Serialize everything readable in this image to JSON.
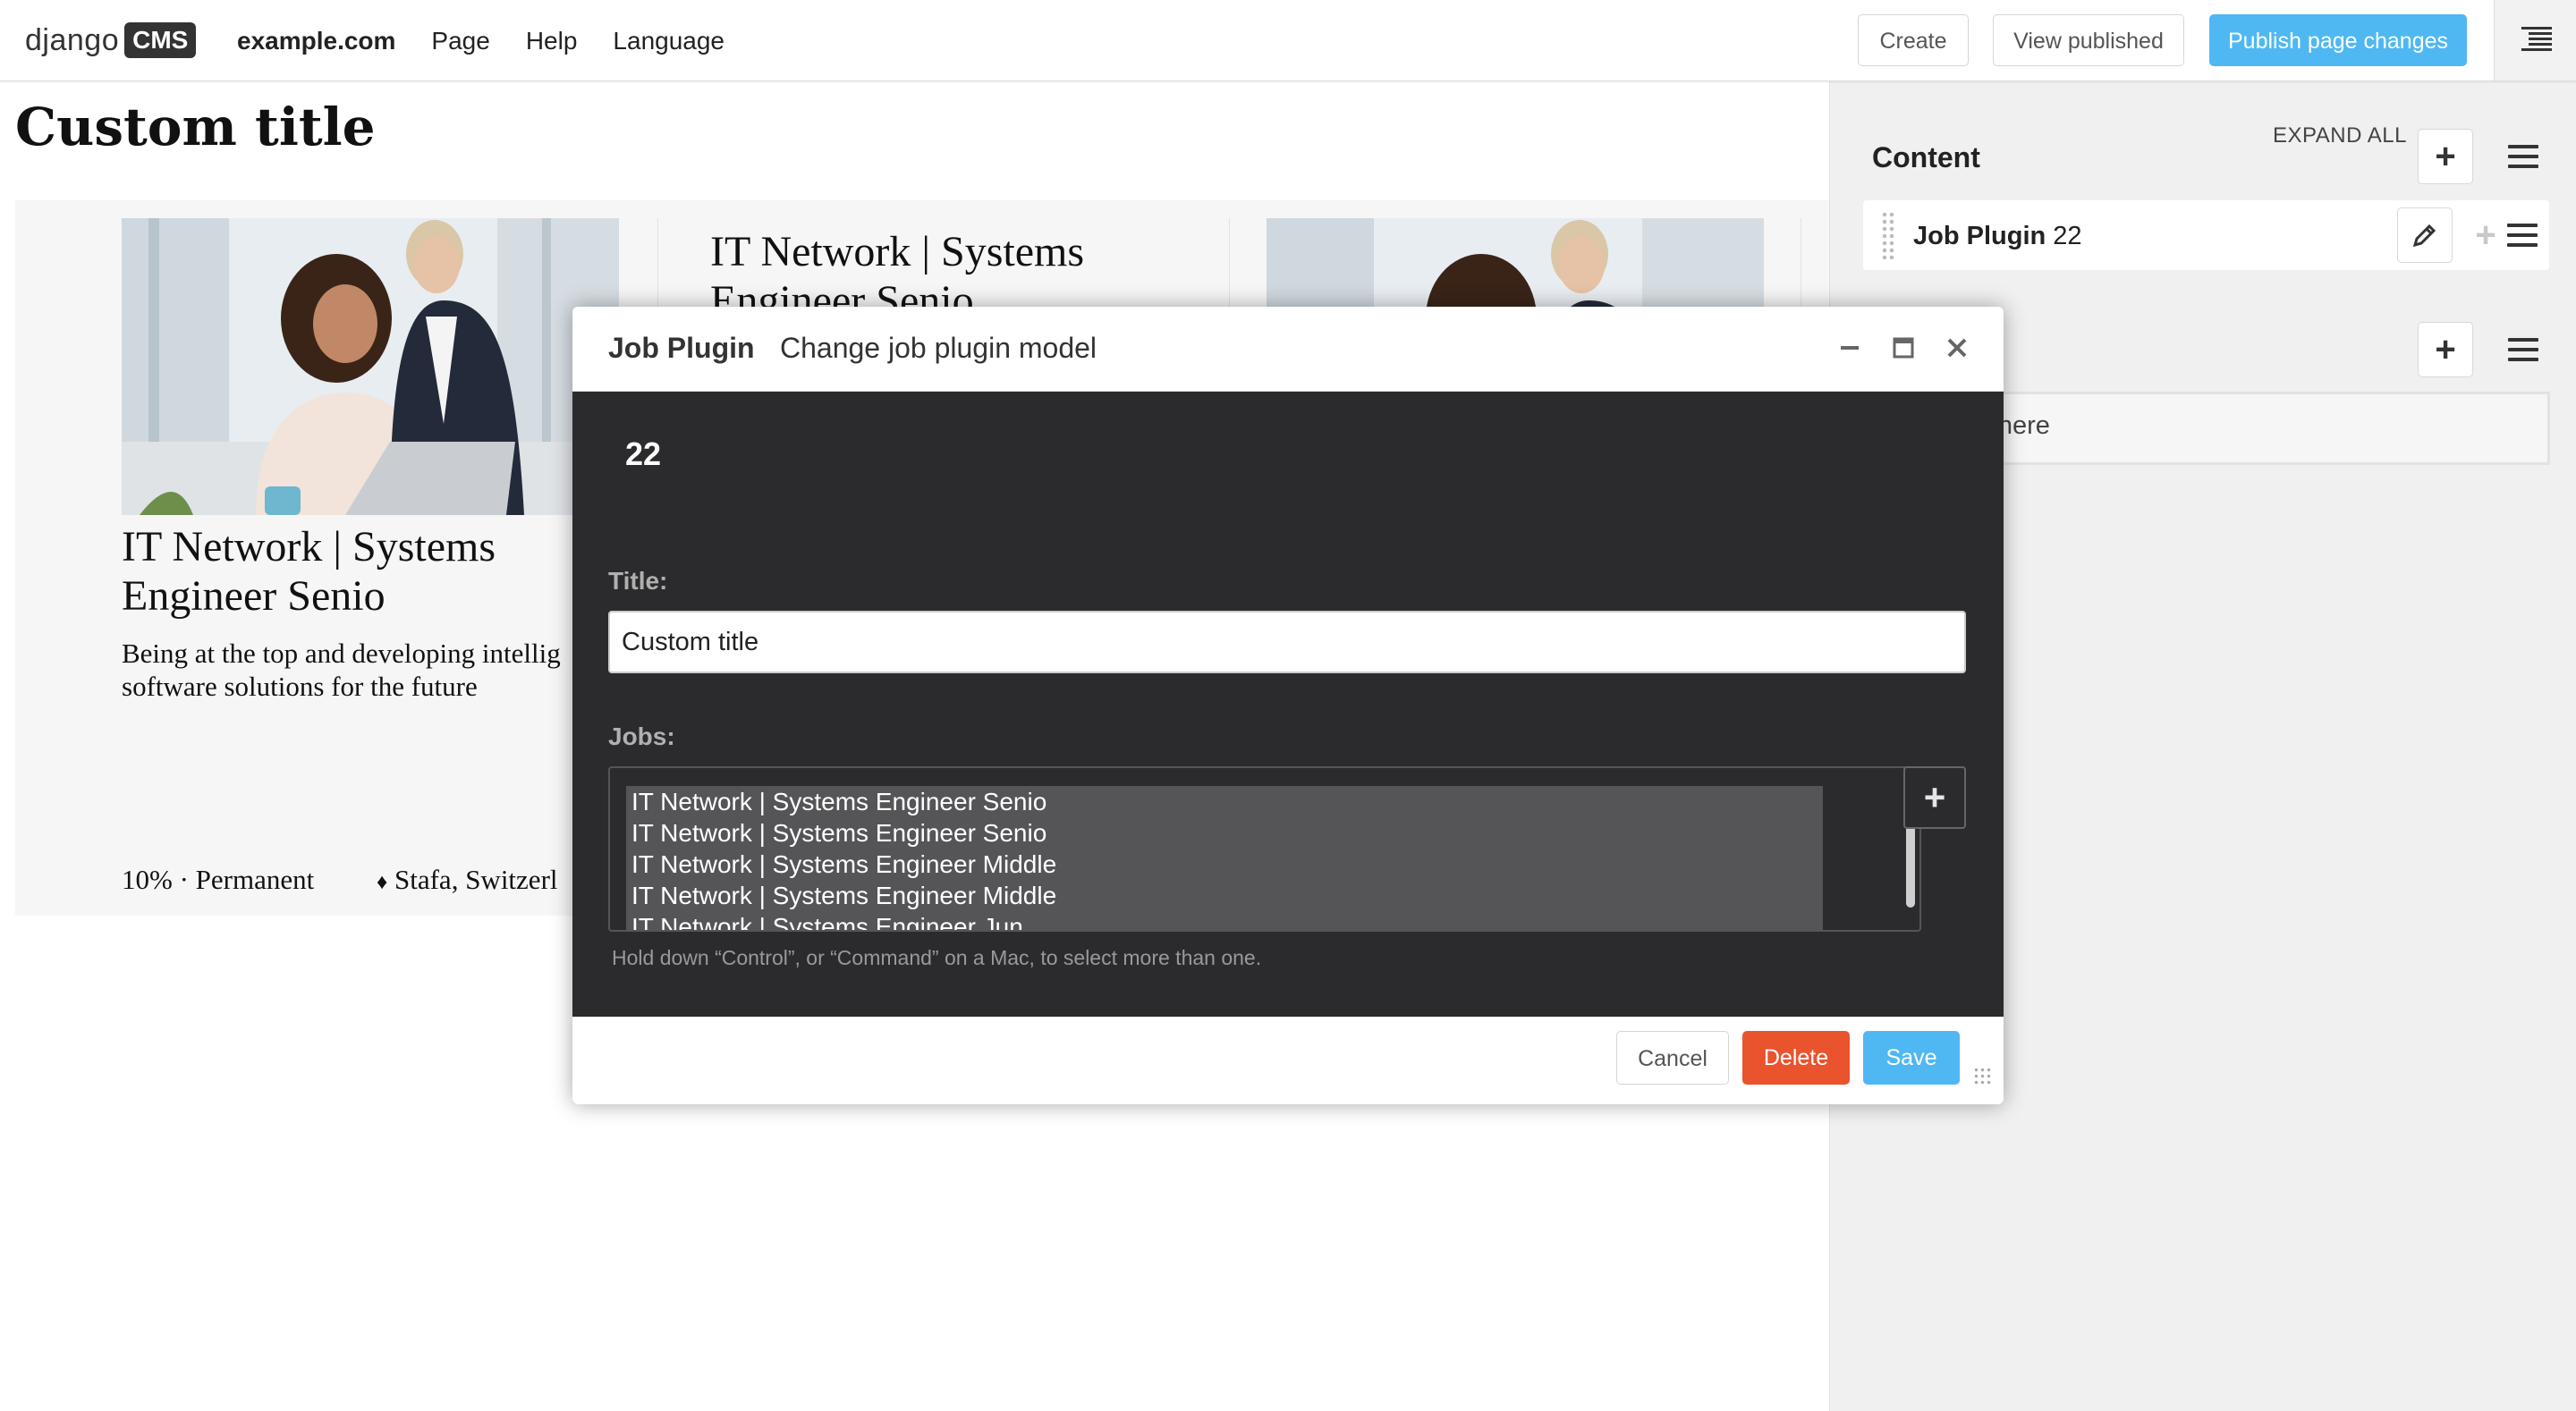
{
  "toolbar": {
    "logo_text": "django",
    "logo_badge": "CMS",
    "menu": [
      "example.com",
      "Page",
      "Help",
      "Language"
    ],
    "create": "Create",
    "view_published": "View published",
    "publish": "Publish page changes",
    "accent": "#4fb8f3"
  },
  "page": {
    "title": "Custom title",
    "cards": [
      {
        "title": "IT Network | Systems Engineer Senio",
        "description": "Being at the top and developing intellig software solutions for the future",
        "workload": "10% · Permanent",
        "location_icon": "diamond-icon",
        "location": "Stafa, Switzerl"
      },
      {
        "title": "IT Network | Systems Engineer Senio"
      }
    ]
  },
  "sidebar": {
    "heading": "Content",
    "expand_all": "EXPAND ALL",
    "plugin": {
      "name": "Job Plugin",
      "id": "22"
    },
    "drop_hint": "ugin here"
  },
  "modal": {
    "plugin_type": "Job Plugin",
    "title": "Change job plugin model",
    "object_id": "22",
    "title_label": "Title:",
    "title_value": "Custom title",
    "jobs_label": "Jobs:",
    "jobs_options": [
      "IT Network | Systems Engineer Senio",
      "IT Network | Systems Engineer Senio",
      "IT Network | Systems Engineer Middle",
      "IT Network | Systems Engineer Middle",
      "IT Network | Systems Engineer Jun"
    ],
    "help_text": "Hold down “Control”, or “Command” on a Mac, to select more than one.",
    "cancel": "Cancel",
    "delete": "Delete",
    "save": "Save",
    "delete_color": "#e9532d",
    "save_color": "#4fb8f3"
  }
}
